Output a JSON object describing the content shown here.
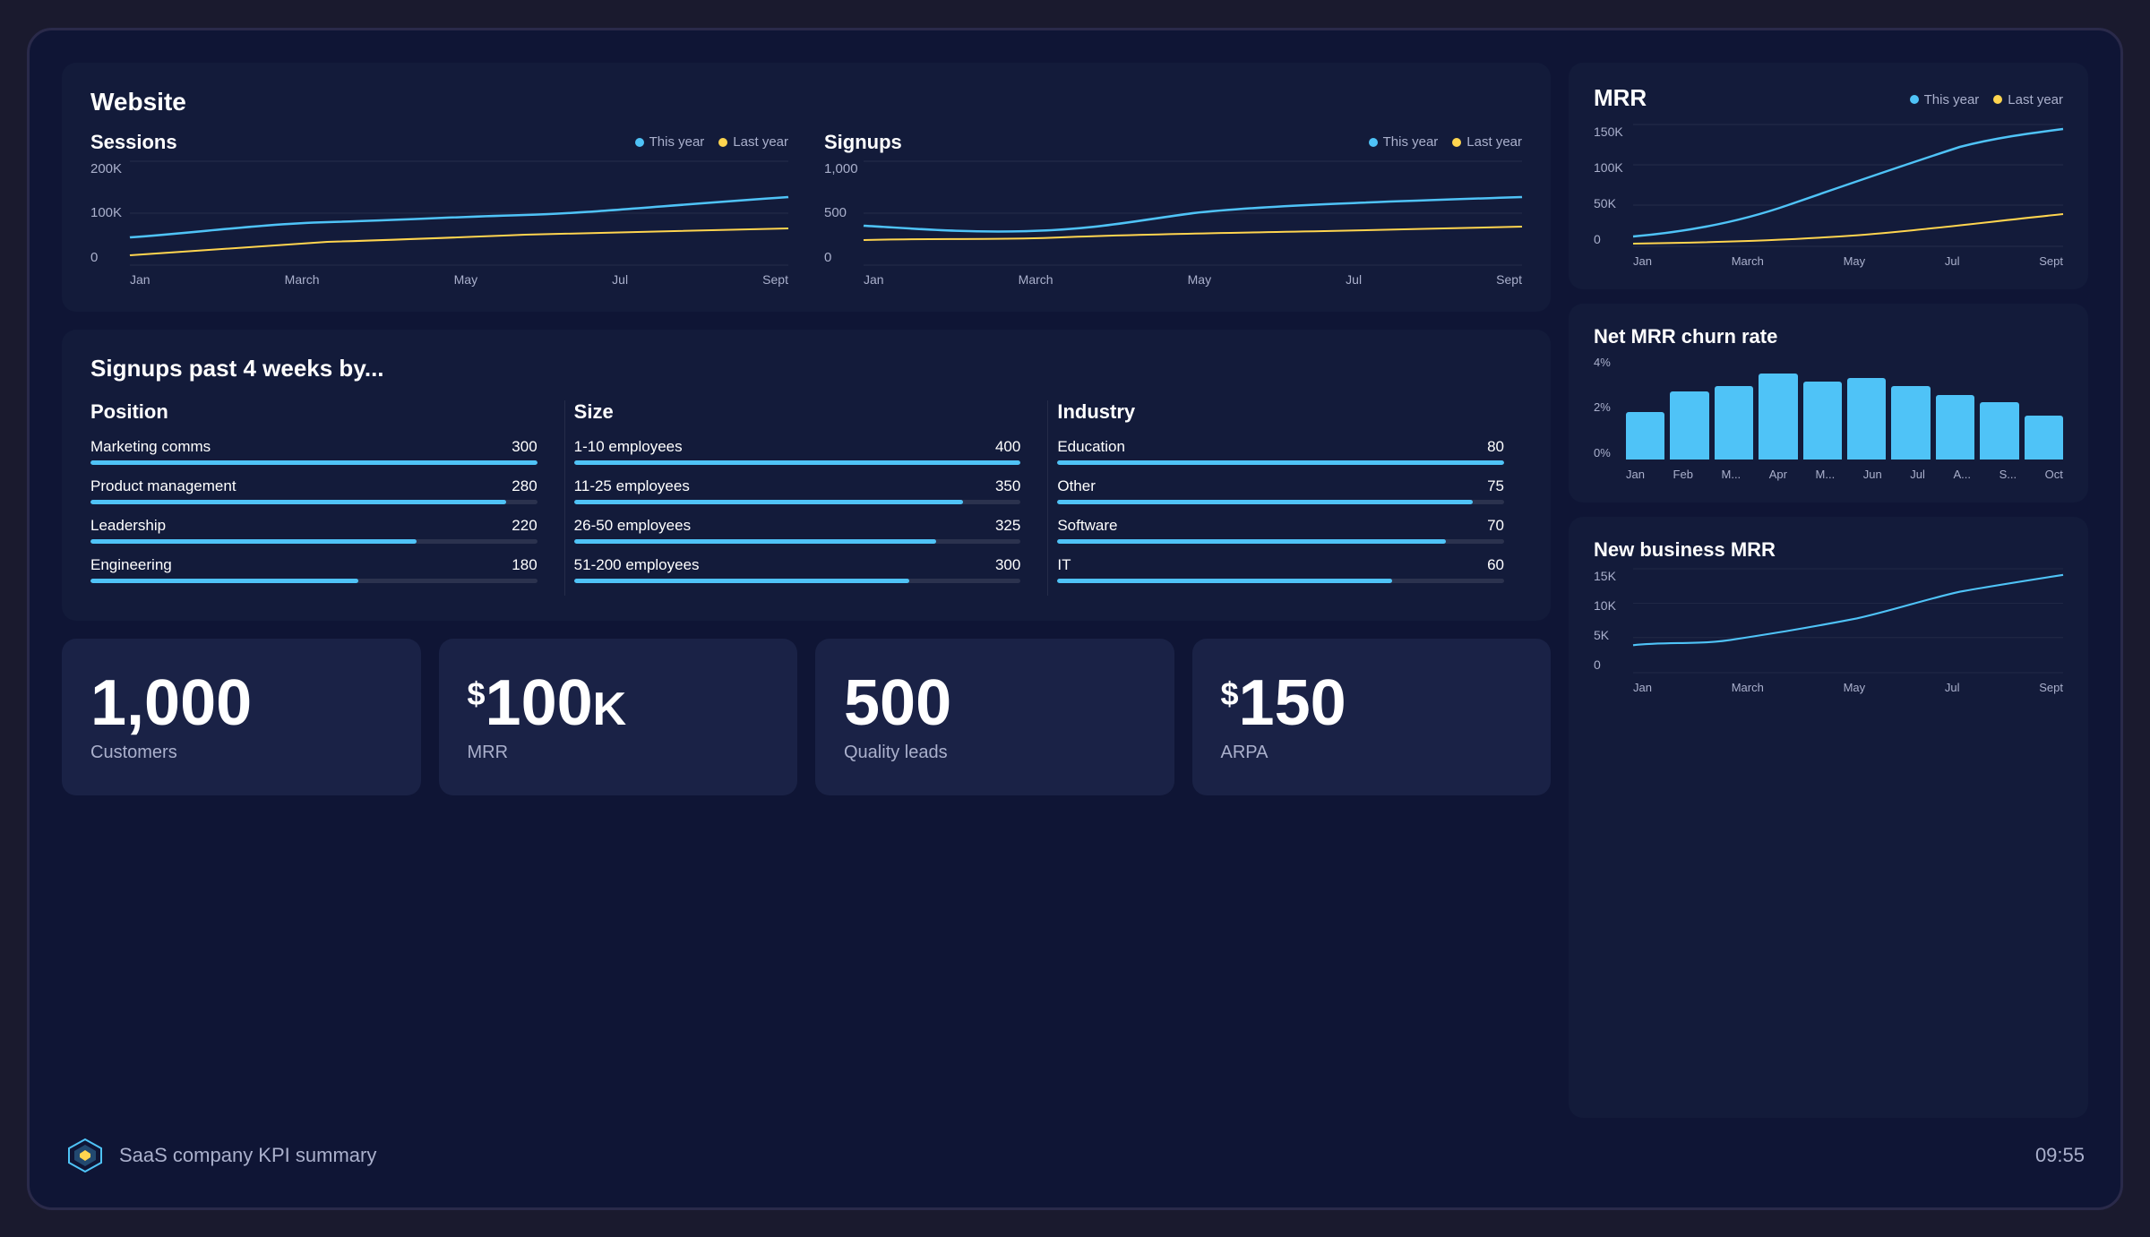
{
  "screen": {
    "background": "#0f1535"
  },
  "footer": {
    "title": "SaaS company KPI summary",
    "time": "09:55"
  },
  "website": {
    "title": "Website",
    "sessions": {
      "label": "Sessions",
      "y_labels": [
        "200K",
        "100K",
        "0"
      ],
      "x_labels": [
        "Jan",
        "March",
        "May",
        "Jul",
        "Sept"
      ],
      "legend_this_year": "This year",
      "legend_last_year": "Last year"
    },
    "signups": {
      "label": "Signups",
      "y_labels": [
        "1,000",
        "500",
        "0"
      ],
      "x_labels": [
        "Jan",
        "March",
        "May",
        "Jul",
        "Sept"
      ],
      "legend_this_year": "This year",
      "legend_last_year": "Last year"
    }
  },
  "signups_4weeks": {
    "title": "Signups past 4 weeks by...",
    "position": {
      "header": "Position",
      "rows": [
        {
          "label": "Marketing comms",
          "value": 300,
          "max": 300,
          "pct": 100
        },
        {
          "label": "Product management",
          "value": 280,
          "max": 300,
          "pct": 93
        },
        {
          "label": "Leadership",
          "value": 220,
          "max": 300,
          "pct": 73
        },
        {
          "label": "Engineering",
          "value": 180,
          "max": 300,
          "pct": 60
        }
      ]
    },
    "size": {
      "header": "Size",
      "rows": [
        {
          "label": "1-10 employees",
          "value": 400,
          "max": 400,
          "pct": 100
        },
        {
          "label": "11-25 employees",
          "value": 350,
          "max": 400,
          "pct": 87
        },
        {
          "label": "26-50 employees",
          "value": 325,
          "max": 400,
          "pct": 81
        },
        {
          "label": "51-200 employees",
          "value": 300,
          "max": 400,
          "pct": 75
        }
      ]
    },
    "industry": {
      "header": "Industry",
      "rows": [
        {
          "label": "Education",
          "value": 80,
          "max": 80,
          "pct": 100
        },
        {
          "label": "Other",
          "value": 75,
          "max": 80,
          "pct": 93
        },
        {
          "label": "Software",
          "value": 70,
          "max": 80,
          "pct": 87
        },
        {
          "label": "IT",
          "value": 60,
          "max": 80,
          "pct": 75
        }
      ]
    }
  },
  "kpis": [
    {
      "number": "1,000",
      "prefix": "",
      "suffix": "",
      "desc": "Customers"
    },
    {
      "number": "100",
      "prefix": "$",
      "suffix": "K",
      "desc": "MRR"
    },
    {
      "number": "500",
      "prefix": "",
      "suffix": "",
      "desc": "Quality leads"
    },
    {
      "number": "150",
      "prefix": "$",
      "suffix": "",
      "desc": "ARPA"
    }
  ],
  "mrr": {
    "title": "MRR",
    "y_labels": [
      "150K",
      "100K",
      "50K",
      "0"
    ],
    "x_labels": [
      "Jan",
      "March",
      "May",
      "Jul",
      "Sept"
    ],
    "legend_this_year": "This year",
    "legend_last_year": "Last year"
  },
  "net_mrr_churn": {
    "title": "Net MRR churn rate",
    "y_labels": [
      "4%",
      "2%",
      "0%"
    ],
    "x_labels": [
      "Jan",
      "Feb",
      "M...",
      "Apr",
      "M...",
      "Jun",
      "Jul",
      "A...",
      "S...",
      "Oct"
    ],
    "bars": [
      35,
      55,
      60,
      72,
      65,
      68,
      60,
      55,
      50,
      40
    ]
  },
  "new_business_mrr": {
    "title": "New business MRR",
    "y_labels": [
      "15K",
      "10K",
      "5K",
      "0"
    ],
    "x_labels": [
      "Jan",
      "March",
      "May",
      "Jul",
      "Sept"
    ]
  }
}
